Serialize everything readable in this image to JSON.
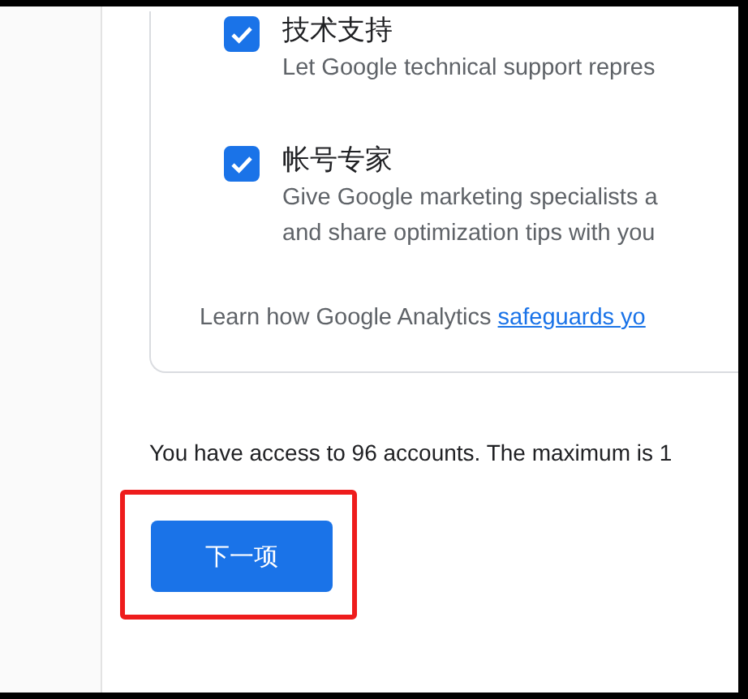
{
  "options": [
    {
      "title": "技术支持",
      "description_lines": [
        "Let Google technical support repres"
      ],
      "checked": true
    },
    {
      "title": "帐号专家",
      "description_lines": [
        "Give Google marketing specialists a",
        "and share optimization tips with you"
      ],
      "checked": true
    }
  ],
  "safeguards_note": {
    "text": "Learn how Google Analytics",
    "link": "safeguards yo"
  },
  "account_notice": "You have access to 96 accounts. The maximum is 1",
  "next_button": {
    "label": "下一项",
    "highlighted": true
  }
}
